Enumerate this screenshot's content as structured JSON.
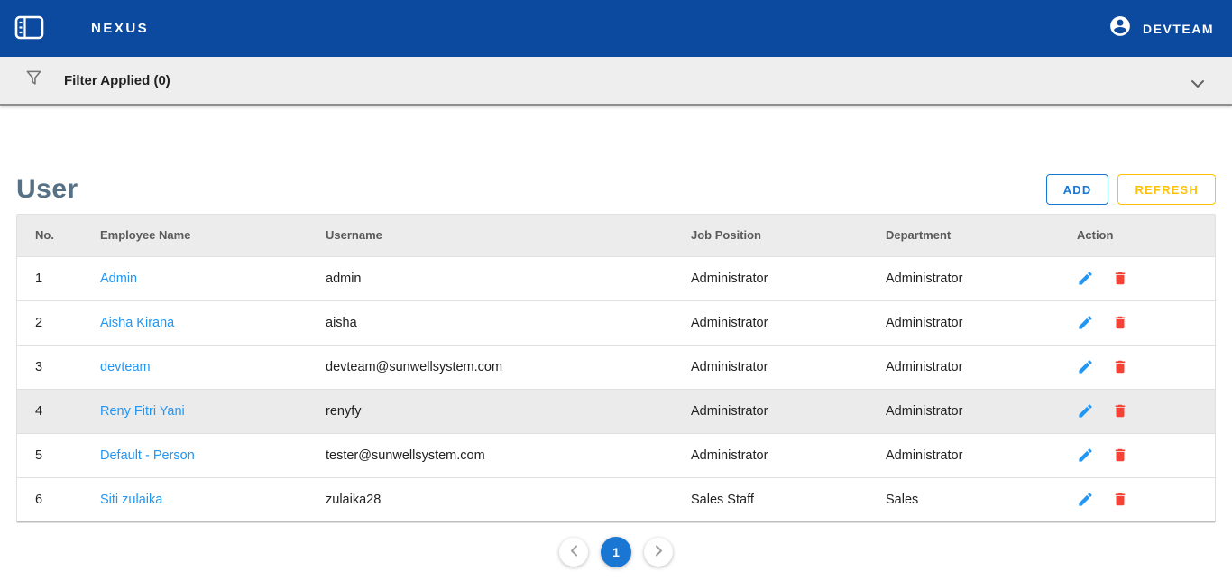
{
  "appbar": {
    "brand": "NEXUS",
    "user": "DEVTEAM"
  },
  "filterbar": {
    "label": "Filter Applied (0)"
  },
  "page": {
    "title": "User",
    "add_label": "ADD",
    "refresh_label": "REFRESH"
  },
  "table": {
    "columns": [
      "No.",
      "Employee Name",
      "Username",
      "Job Position",
      "Department",
      "Action"
    ],
    "rows": [
      {
        "no": "1",
        "name": "Admin",
        "username": "admin",
        "position": "Administrator",
        "department": "Administrator"
      },
      {
        "no": "2",
        "name": "Aisha Kirana",
        "username": "aisha",
        "position": "Administrator",
        "department": "Administrator"
      },
      {
        "no": "3",
        "name": "devteam",
        "username": "devteam@sunwellsystem.com",
        "position": "Administrator",
        "department": "Administrator"
      },
      {
        "no": "4",
        "name": "Reny Fitri Yani",
        "username": "renyfy",
        "position": "Administrator",
        "department": "Administrator"
      },
      {
        "no": "5",
        "name": "Default - Person",
        "username": "tester@sunwellsystem.com",
        "position": "Administrator",
        "department": "Administrator"
      },
      {
        "no": "6",
        "name": "Siti zulaika",
        "username": "zulaika28",
        "position": "Sales Staff",
        "department": "Sales"
      }
    ]
  },
  "pagination": {
    "current": "1"
  },
  "icons": {
    "sidebar_toggle": "sidebar-panel-icon",
    "account": "account-circle-icon",
    "filter": "funnel-icon",
    "expand": "chevron-down-icon",
    "edit": "pencil-icon",
    "delete": "trash-icon",
    "prev": "chevron-left-icon",
    "next": "chevron-right-icon"
  },
  "colors": {
    "navbar": "#0c4aa0",
    "title": "#567086",
    "link": "#2196f3",
    "add_accent": "#1976d2",
    "refresh_accent": "#ffc107",
    "edit_icon": "#2196f3",
    "delete_icon": "#f44336",
    "active_page": "#1976d2",
    "row_highlight": "#ebebeb"
  }
}
